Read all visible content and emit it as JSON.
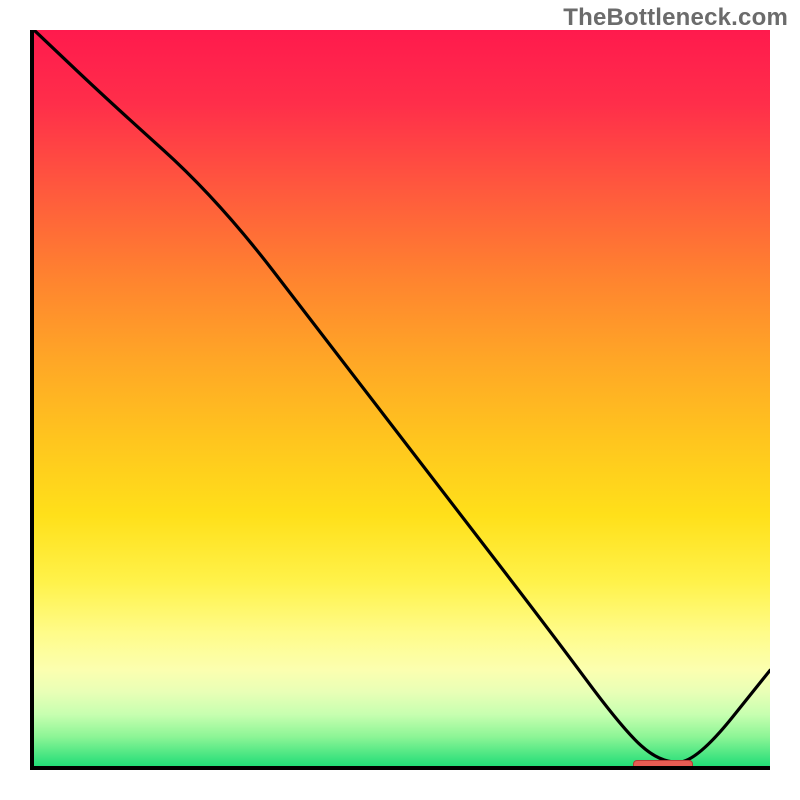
{
  "watermark": "TheBottleneck.com",
  "colors": {
    "accent_marker": "#e85c53",
    "line": "#000000"
  },
  "chart_data": {
    "type": "line",
    "title": "",
    "xlabel": "",
    "ylabel": "",
    "xlim": [
      0,
      100
    ],
    "ylim": [
      0,
      100
    ],
    "grid": false,
    "legend": false,
    "series": [
      {
        "name": "bottleneck-curve",
        "x": [
          0,
          10,
          25,
          40,
          55,
          70,
          80,
          85,
          90,
          100
        ],
        "y": [
          100,
          90.5,
          77,
          57.5,
          38,
          18.5,
          5,
          0.5,
          0.5,
          13
        ]
      }
    ],
    "annotations": [
      {
        "name": "optimal-range-marker",
        "x_start": 81,
        "x_end": 89,
        "y": 0.7,
        "color": "#e85c53"
      }
    ]
  }
}
